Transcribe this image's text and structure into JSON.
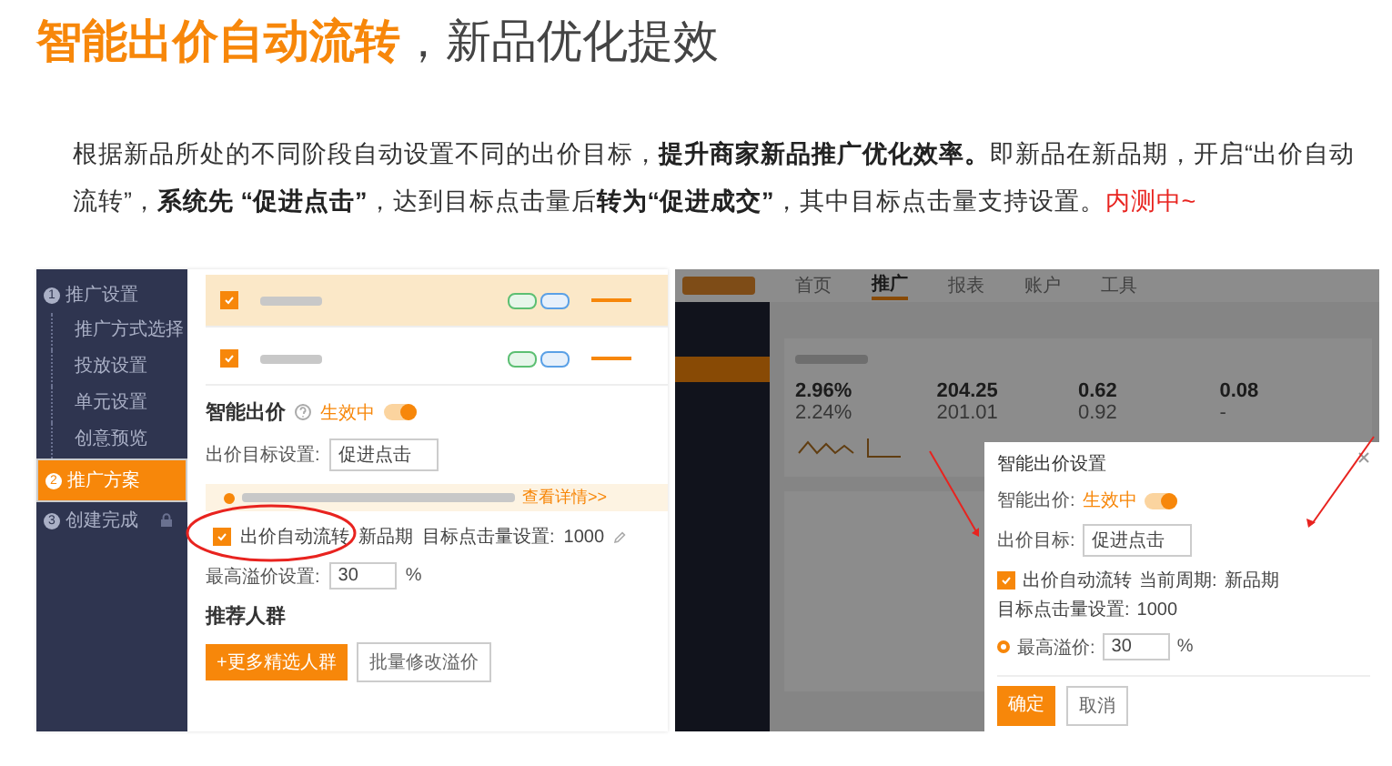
{
  "title": {
    "highlight": "智能出价自动流转",
    "rest": "，新品优化提效"
  },
  "description": "根据新品所处的不同阶段自动设置不同的出价目标，**提升商家新品推广优化效率。**即新品在新品期，开启“出价自动流转”，**系统先 “促进点击”**，达到目标点击量后**转为“促进成交”**，其中目标点击量支持设置。",
  "description_tag": "内测中~",
  "left_screenshot": {
    "steps": [
      {
        "kind": "step",
        "number": "1",
        "label": "推广设置",
        "selected": false,
        "locked": false
      },
      {
        "kind": "substep",
        "label": "推广方式选择"
      },
      {
        "kind": "substep",
        "label": "投放设置"
      },
      {
        "kind": "substep",
        "label": "单元设置"
      },
      {
        "kind": "substep",
        "label": "创意预览"
      },
      {
        "kind": "step",
        "number": "2",
        "label": "推广方案",
        "selected": true,
        "locked": false
      },
      {
        "kind": "step",
        "number": "3",
        "label": "创建完成",
        "selected": false,
        "locked": true
      }
    ],
    "product_rows": [
      {
        "checked": true,
        "highlighted": true
      },
      {
        "checked": true,
        "highlighted": false
      }
    ],
    "smart_bid": {
      "label": "智能出价",
      "status": "生效中",
      "on": true,
      "target_label": "出价目标设置:",
      "target_value": "促进点击",
      "notice_link": "查看详情>>",
      "auto_flow": {
        "checked": true,
        "label": "出价自动流转",
        "stage": "新品期",
        "clicks_label": "目标点击量设置:",
        "clicks": "1000"
      },
      "premium_label": "最高溢价设置:",
      "premium_value": "30",
      "premium_unit": "%"
    },
    "audience": {
      "title": "推荐人群",
      "buttons": [
        {
          "kind": "primary",
          "label": "+更多精选人群"
        },
        {
          "kind": "secondary",
          "label": "批量修改溢价"
        }
      ]
    }
  },
  "right_screenshot": {
    "nav": [
      {
        "label": "首页",
        "selected": false
      },
      {
        "label": "推广",
        "selected": true
      },
      {
        "label": "报表",
        "selected": false
      },
      {
        "label": "账户",
        "selected": false
      },
      {
        "label": "工具",
        "selected": false
      }
    ],
    "metrics": [
      {
        "value": "2.96%",
        "previous": "2.24%"
      },
      {
        "value": "204.25",
        "previous": "201.01"
      },
      {
        "value": "0.62",
        "previous": "0.92"
      },
      {
        "value": "0.08",
        "previous": "-"
      }
    ],
    "modal": {
      "title": "智能出价设置",
      "bid_label": "智能出价:",
      "status": "生效中",
      "on": true,
      "target_label": "出价目标:",
      "target_value": "促进点击",
      "auto_flow": {
        "checked": true,
        "label": "出价自动流转",
        "period_label": "当前周期:",
        "period": "新品期",
        "clicks_label": "目标点击量设置:",
        "clicks": "1000"
      },
      "premium_selected": true,
      "premium_label": "最高溢价:",
      "premium_value": "30",
      "premium_unit": "%",
      "confirm": "确定",
      "cancel": "取消"
    }
  }
}
